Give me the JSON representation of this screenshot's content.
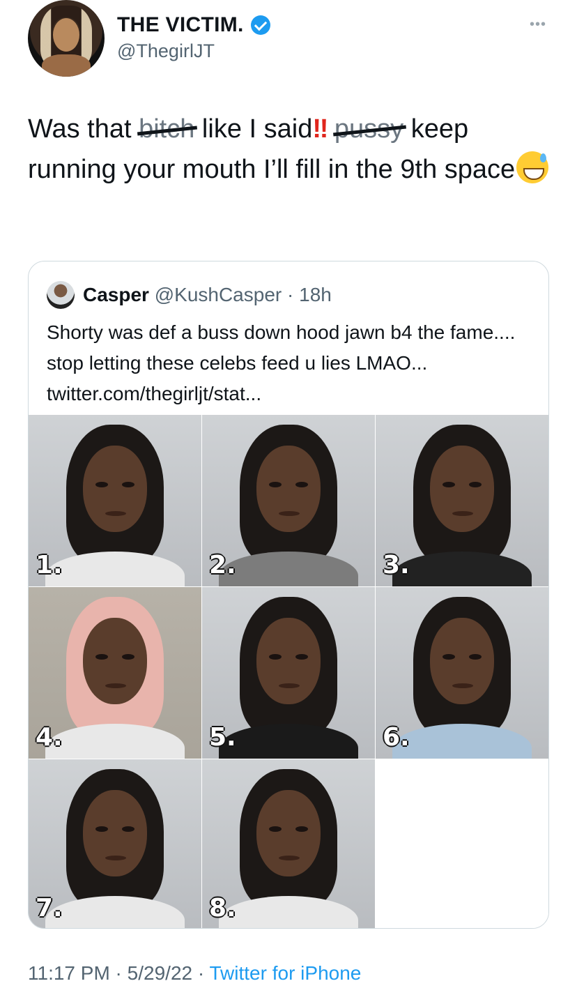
{
  "author": {
    "display_name": "THE VICTIM.",
    "handle": "@ThegirlJT",
    "verified": true
  },
  "tweet": {
    "text_part1": "Was that ",
    "struck_word_1": "bitch",
    "text_part2": " like I said",
    "exclamation": "‼",
    "struck_word_2": "pussy",
    "text_part3": " keep running your mouth I’ll fill in the 9th space",
    "emoji": "grinning-face-with-sweat"
  },
  "quoted_tweet": {
    "name": "Casper",
    "handle": "@KushCasper",
    "time": "18h",
    "text": "Shorty was def a buss down hood jawn b4 the fame.... stop letting these celebs feed u lies LMAO... twitter.com/thegirljt/stat...",
    "photo_labels": [
      "1.",
      "2.",
      "3.",
      "4.",
      "5.",
      "6.",
      "7.",
      "8."
    ]
  },
  "footer": {
    "time": "11:17 PM",
    "date": "5/29/22",
    "separator": " · ",
    "source": "Twitter for iPhone"
  },
  "colors": {
    "accent": "#1d9bf0",
    "text": "#0f1419",
    "secondary": "#536471",
    "border": "#cfd9de"
  }
}
